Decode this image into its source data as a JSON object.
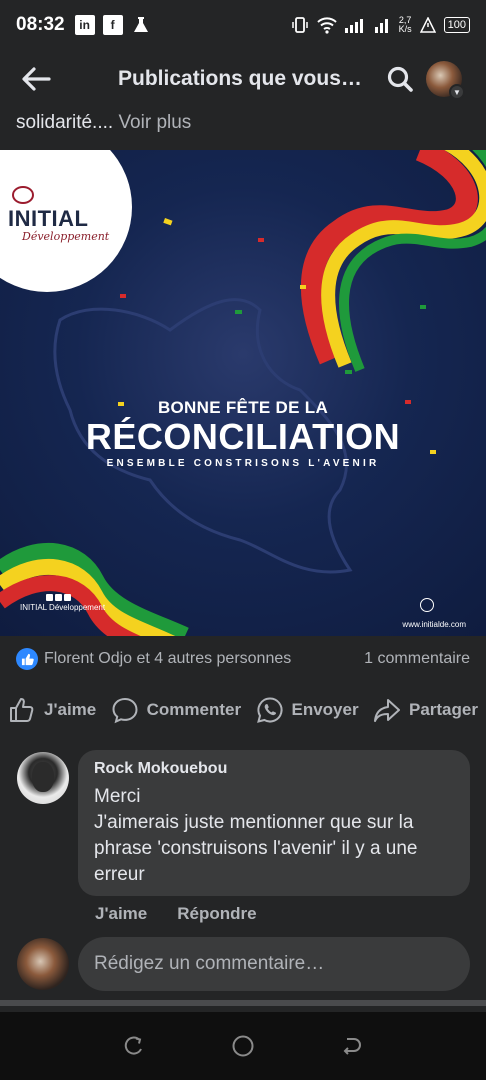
{
  "status_bar": {
    "time": "08:32",
    "left_icons": [
      "linkedin-icon",
      "facebook-icon",
      "flask-icon"
    ],
    "net_speed_value": "2,7",
    "net_speed_unit": "K/s",
    "battery": "100"
  },
  "header": {
    "title": "Publications que vous…"
  },
  "post": {
    "snippet": "solidarité....",
    "see_more": "Voir plus",
    "image": {
      "logo_name": "INITIAL",
      "logo_sub": "Développement",
      "line1": "BONNE FÊTE DE LA",
      "line2": "RÉCONCILIATION",
      "line3": "ENSEMBLE CONSTRISONS L'AVENIR",
      "footer_left": "INITIAL Développement",
      "footer_right": "www.initialde.com"
    },
    "reactions_text": "Florent Odjo et 4 autres personnes",
    "comments_count": "1 commentaire",
    "actions": {
      "like": "J'aime",
      "comment": "Commenter",
      "send": "Envoyer",
      "share": "Partager"
    }
  },
  "comment": {
    "author": "Rock Mokouebou",
    "text_line1": "Merci",
    "text_rest": "J'aimerais juste mentionner que sur la phrase 'construisons l'avenir' il y a une erreur",
    "like": "J'aime",
    "reply": "Répondre"
  },
  "composer": {
    "placeholder": "Rédigez un commentaire…"
  },
  "colors": {
    "background": "#242526",
    "bubble": "#3a3b3c",
    "like_blue": "#2d88ff",
    "poster_navy": "#152651"
  }
}
